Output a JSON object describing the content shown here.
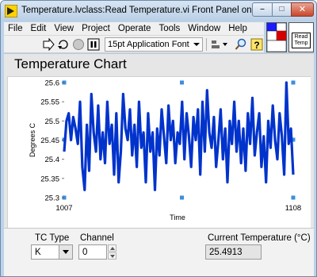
{
  "window": {
    "title": "Temperature.lvclass:Read Temperature.vi Front Panel on OO..."
  },
  "menu": [
    "File",
    "Edit",
    "View",
    "Project",
    "Operate",
    "Tools",
    "Window",
    "Help"
  ],
  "toolbar": {
    "font": "15pt Application Font",
    "icons": [
      "run-arrow-icon",
      "run-continuous-icon",
      "abort-icon",
      "pause-icon",
      "align-icon",
      "zoom-icon",
      "help-icon"
    ]
  },
  "vi_icon": {
    "label_line1": "Read",
    "label_line2": "Temp"
  },
  "chart_data": {
    "type": "line",
    "title": "Temperature Chart",
    "xlabel": "Time",
    "ylabel": "Degrees C",
    "xlim": [
      1007,
      1108
    ],
    "ylim": [
      25.3,
      25.6
    ],
    "x_ticks": [
      "1007",
      "1108"
    ],
    "y_ticks": [
      "25.6",
      "25.55",
      "25.5",
      "25.45",
      "25.4",
      "25.35",
      "25.3"
    ],
    "series": [
      {
        "color": "#0033cc",
        "x_start": 1007,
        "values": [
          25.42,
          25.5,
          25.52,
          25.45,
          25.51,
          25.48,
          25.44,
          25.55,
          25.38,
          25.32,
          25.49,
          25.37,
          25.57,
          25.47,
          25.42,
          25.54,
          25.4,
          25.47,
          25.39,
          25.55,
          25.44,
          25.49,
          25.36,
          25.52,
          25.34,
          25.42,
          25.57,
          25.48,
          25.45,
          25.53,
          25.41,
          25.49,
          25.38,
          25.55,
          25.43,
          25.47,
          25.34,
          25.52,
          25.42,
          25.47,
          25.32,
          25.48,
          25.41,
          25.53,
          25.46,
          25.39,
          25.54,
          25.45,
          25.5,
          25.39,
          25.47,
          25.44,
          25.55,
          25.4,
          25.52,
          25.46,
          25.38,
          25.51,
          25.45,
          25.53,
          25.36,
          25.55,
          25.42,
          25.58,
          25.47,
          25.43,
          25.51,
          25.38,
          25.45,
          25.53,
          25.4,
          25.48,
          25.34,
          25.5,
          25.44,
          25.55,
          25.42,
          25.5,
          25.39,
          25.48,
          25.37,
          25.52,
          25.44,
          25.56,
          25.41,
          25.47,
          25.52,
          25.38,
          25.46,
          25.34,
          25.5,
          25.43,
          25.54,
          25.45,
          25.4,
          25.52,
          25.46,
          25.36,
          25.6,
          25.44,
          25.48,
          25.36
        ]
      }
    ]
  },
  "controls": {
    "tc_type_label": "TC Type",
    "tc_type_value": "K",
    "channel_label": "Channel",
    "channel_value": "0",
    "current_temp_label": "Current Temperature (°C)",
    "current_temp_value": "25.4913"
  }
}
